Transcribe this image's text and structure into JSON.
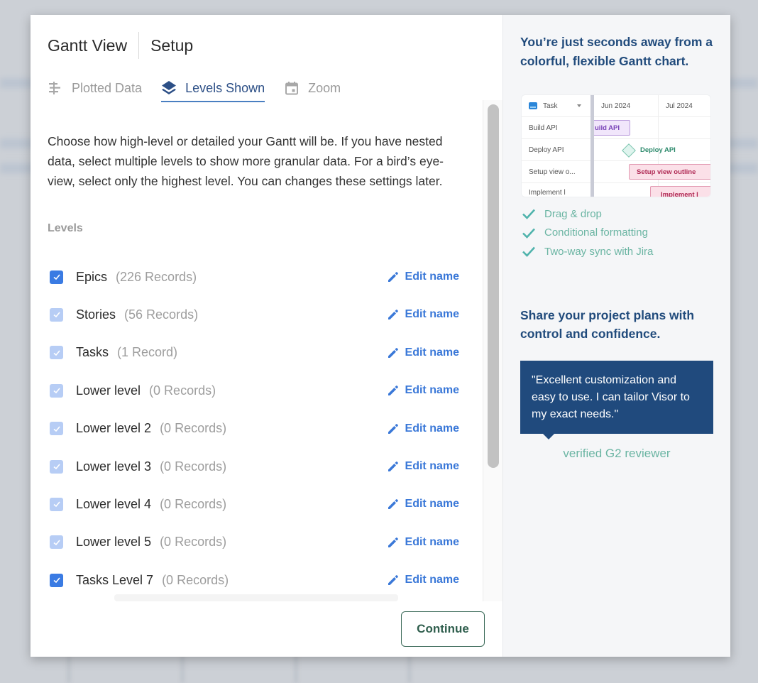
{
  "header": {
    "title": "Gantt View",
    "subtitle": "Setup"
  },
  "tabs": [
    {
      "label": "Plotted Data",
      "icon": "plotted-data-icon",
      "active": false
    },
    {
      "label": "Levels Shown",
      "icon": "layers-icon",
      "active": true
    },
    {
      "label": "Zoom",
      "icon": "calendar-icon",
      "active": false
    }
  ],
  "description": "Choose how high-level or detailed your Gantt will be. If you have nested data, select multiple levels to show more granular data. For a bird’s eye-view, select only the highest level. You can changes these settings later.",
  "levels_label": "Levels",
  "levels": [
    {
      "name": "Epics",
      "count": "(226 Records)",
      "checked": true,
      "disabled": false,
      "edit_label": "Edit name"
    },
    {
      "name": "Stories",
      "count": "(56 Records)",
      "checked": true,
      "disabled": true,
      "edit_label": "Edit name"
    },
    {
      "name": "Tasks",
      "count": "(1 Record)",
      "checked": true,
      "disabled": true,
      "edit_label": "Edit name"
    },
    {
      "name": "Lower level",
      "count": "(0 Records)",
      "checked": true,
      "disabled": true,
      "edit_label": "Edit name"
    },
    {
      "name": "Lower level 2",
      "count": "(0 Records)",
      "checked": true,
      "disabled": true,
      "edit_label": "Edit name"
    },
    {
      "name": "Lower level 3",
      "count": "(0 Records)",
      "checked": true,
      "disabled": true,
      "edit_label": "Edit name"
    },
    {
      "name": "Lower level 4",
      "count": "(0 Records)",
      "checked": true,
      "disabled": true,
      "edit_label": "Edit name"
    },
    {
      "name": "Lower level 5",
      "count": "(0 Records)",
      "checked": true,
      "disabled": true,
      "edit_label": "Edit name"
    },
    {
      "name": "Tasks Level 7",
      "count": "(0 Records)",
      "checked": true,
      "disabled": false,
      "edit_label": "Edit name"
    }
  ],
  "continue_label": "Continue",
  "promo": {
    "title": "You’re just seconds away from a colorful, flexible Gantt chart.",
    "preview": {
      "column_header": "Task",
      "months": [
        "Jun 2024",
        "Jul 2024"
      ],
      "rows": [
        {
          "task": "Build API",
          "bar": "uild API"
        },
        {
          "task": "Deploy API",
          "bar": "Deploy API"
        },
        {
          "task": "Setup view o...",
          "bar": "Setup view outline"
        },
        {
          "task": "Implement l",
          "bar": "Implement l"
        }
      ]
    },
    "features": [
      "Drag & drop",
      "Conditional formatting",
      "Two-way sync with Jira"
    ],
    "subtitle": "Share your project plans with control and confidence.",
    "quote": "\"Excellent customization and easy to use. I can tailor Visor to my exact needs.\"",
    "reviewer": "verified G2 reviewer"
  },
  "colors": {
    "accent": "#3a7be3",
    "tab_active": "#2c4f86",
    "promo_heading": "#214b7c",
    "feature_green": "#6bb5a3",
    "quote_bg": "#204a7d",
    "continue_border": "#3d6b5a"
  }
}
